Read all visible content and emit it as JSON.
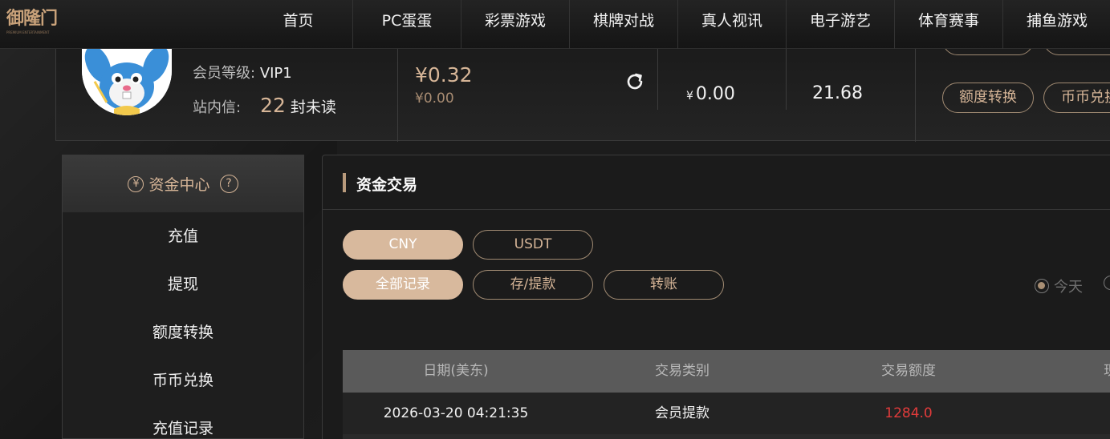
{
  "brand": {
    "logo_text": "御隆门",
    "logo_sub": "PREMIUM ENTERTAINMENT"
  },
  "nav": {
    "items": [
      {
        "label": "首页"
      },
      {
        "label": "PC蛋蛋"
      },
      {
        "label": "彩票游戏"
      },
      {
        "label": "棋牌对战"
      },
      {
        "label": "真人视讯"
      },
      {
        "label": "电子游艺"
      },
      {
        "label": "体育赛事"
      },
      {
        "label": "捕鱼游戏"
      }
    ]
  },
  "account": {
    "vip_label": "会员等级:",
    "vip_value": "VIP1",
    "msg_label": "站内信:",
    "msg_count": "22",
    "msg_unread": "封未读",
    "balance_main": "¥0.32",
    "balance_sub": "¥0.00",
    "balance2_currency": "¥",
    "balance2_value": "0.00",
    "balance3_value": "21.68",
    "actions": {
      "transfer": "额度转换",
      "exchange": "币币兑换"
    }
  },
  "sidebar": {
    "header": "资金中心",
    "header_icon": "yen-circle-icon",
    "help_icon": "?",
    "items": [
      {
        "label": "充值"
      },
      {
        "label": "提现"
      },
      {
        "label": "额度转换"
      },
      {
        "label": "币币兑换"
      },
      {
        "label": "充值记录"
      }
    ]
  },
  "main": {
    "title": "资金交易",
    "currency_tabs": [
      {
        "label": "CNY",
        "active": true
      },
      {
        "label": "USDT",
        "active": false
      }
    ],
    "record_tabs": [
      {
        "label": "全部记录",
        "active": true
      },
      {
        "label": "存/提款",
        "active": false
      },
      {
        "label": "转账",
        "active": false
      }
    ],
    "date_filter": {
      "today": "今天"
    },
    "table": {
      "headers": [
        "日期(美东)",
        "交易类别",
        "交易额度",
        "现"
      ],
      "rows": [
        [
          "2026-03-20 04:21:35",
          "会员提款",
          "1284.0",
          ""
        ]
      ]
    }
  },
  "colors": {
    "accent": "#d6b597",
    "active_button": "#d8b99d",
    "negative_amount": "#e23b3b",
    "background": "#1c1c1c"
  }
}
